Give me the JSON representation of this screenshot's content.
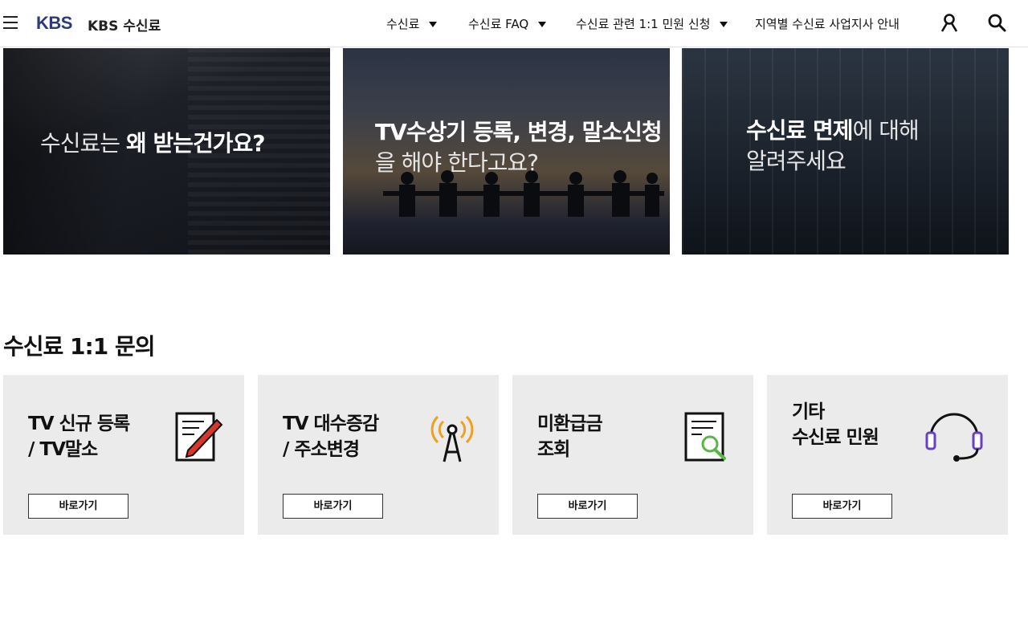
{
  "header": {
    "logo": "KBS",
    "site_name": "KBS 수신료",
    "nav": [
      "수신료",
      "수신료 FAQ",
      "수신료 관련 1:1 민원 신청",
      "지역별 수신료 사업지사 안내"
    ],
    "icons": [
      "menu-icon",
      "user-icon",
      "search-icon"
    ]
  },
  "banners": [
    {
      "line1_light": "수신료는 ",
      "line1_bold": "왜 받는건가요?"
    },
    {
      "line1_bold": "TV수상기 등록, 변경, 말소신청",
      "line2_light": "을 해야 한다고요?"
    },
    {
      "line1_bold": "수신료 면제",
      "line1_light": "에 대해",
      "line2_light": "알려주세요"
    }
  ],
  "section": {
    "title": "수신료 1:1 문의",
    "cards": [
      {
        "line1": "TV 신규 등록",
        "line2": "/ TV말소",
        "button": "바로가기",
        "icon": "document-pen-icon"
      },
      {
        "line1": "TV 대수증감",
        "line2": "/ 주소변경",
        "button": "바로가기",
        "icon": "antenna-signal-icon"
      },
      {
        "line1": "미환급금",
        "line2": "조회",
        "button": "바로가기",
        "icon": "document-search-icon"
      },
      {
        "line1": "기타",
        "line2": "수신료 민원",
        "button": "바로가기",
        "icon": "headset-icon"
      }
    ]
  },
  "colors": {
    "logo": "#2a3a7a",
    "card_bg": "#ebebeb",
    "pen": "#d9352b",
    "signal": "#f0a020",
    "magnifier": "#5ab54a",
    "headset": "#6a3fc0"
  }
}
